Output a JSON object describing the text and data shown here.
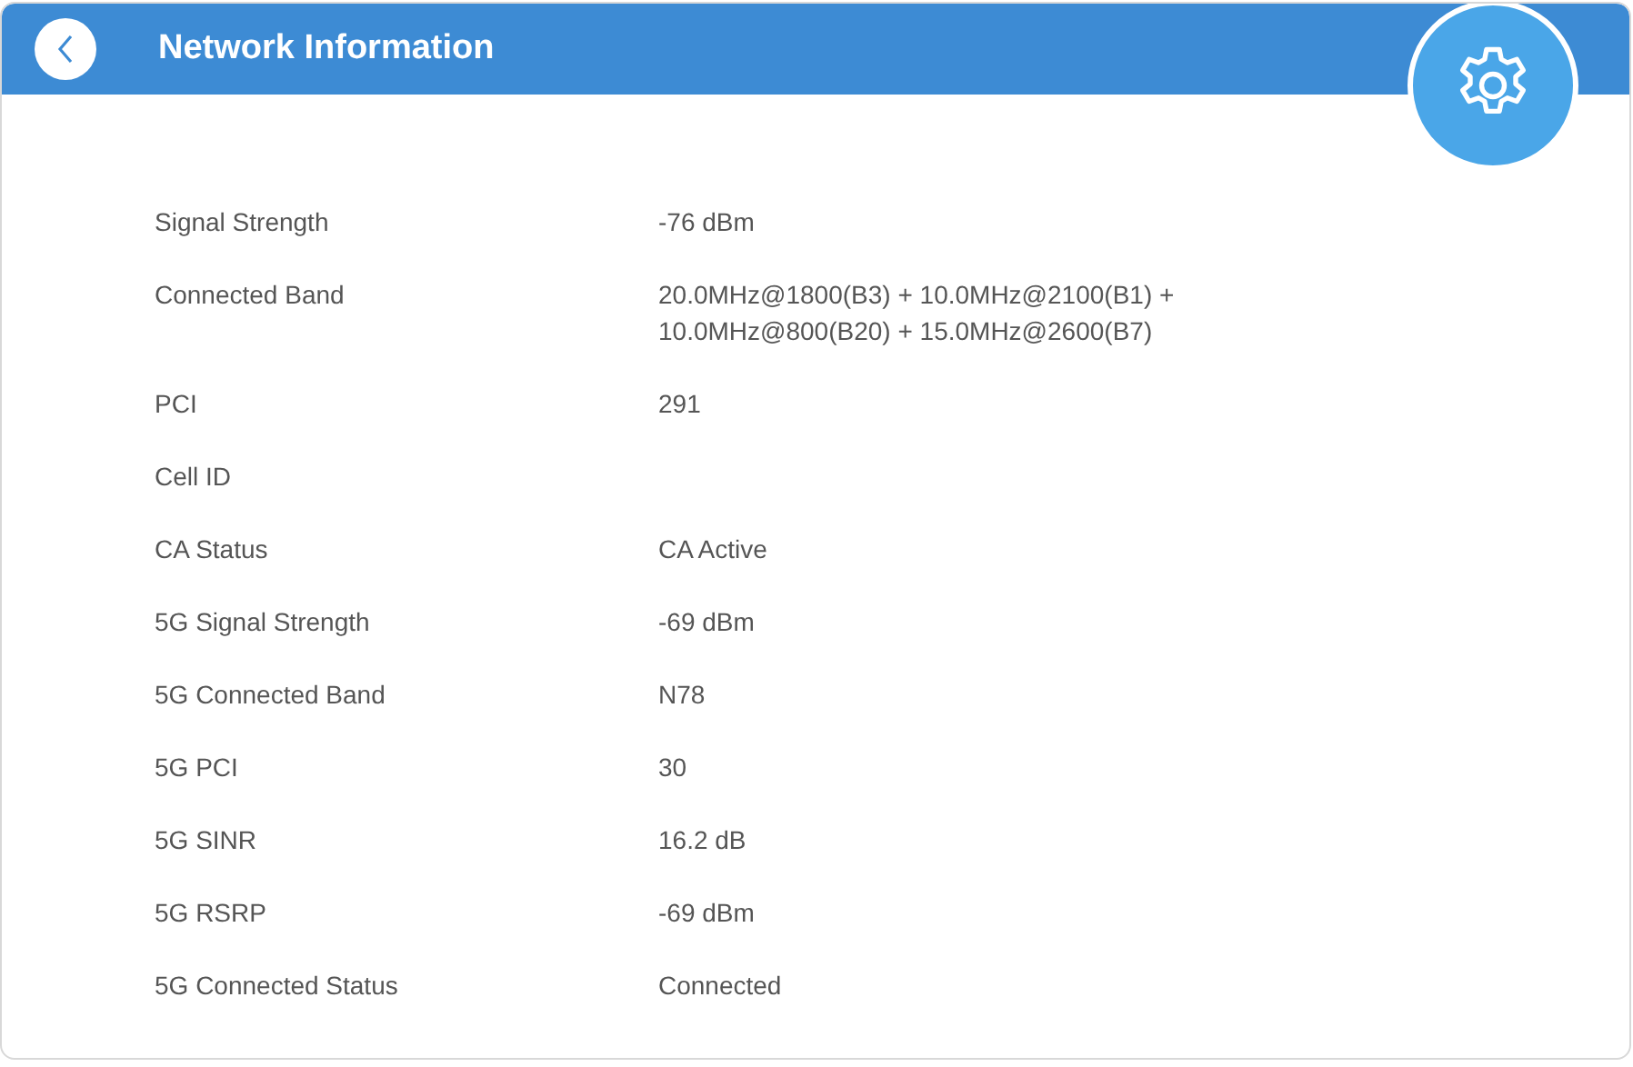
{
  "header": {
    "title": "Network Information"
  },
  "rows": [
    {
      "label": "Signal Strength",
      "value": "-76 dBm"
    },
    {
      "label": "Connected Band",
      "value": "20.0MHz@1800(B3) + 10.0MHz@2100(B1) + 10.0MHz@800(B20) + 15.0MHz@2600(B7)"
    },
    {
      "label": "PCI",
      "value": "291"
    },
    {
      "label": "Cell ID"
    },
    {
      "label": "CA Status",
      "value": "CA Active"
    },
    {
      "label": "5G Signal Strength",
      "value": "-69 dBm"
    },
    {
      "label": "5G Connected Band",
      "value": "N78"
    },
    {
      "label": "5G PCI",
      "value": "30"
    },
    {
      "label": "5G SINR",
      "value": "16.2 dB"
    },
    {
      "label": "5G RSRP",
      "value": "-69 dBm"
    },
    {
      "label": "5G Connected Status",
      "value": "Connected"
    }
  ]
}
